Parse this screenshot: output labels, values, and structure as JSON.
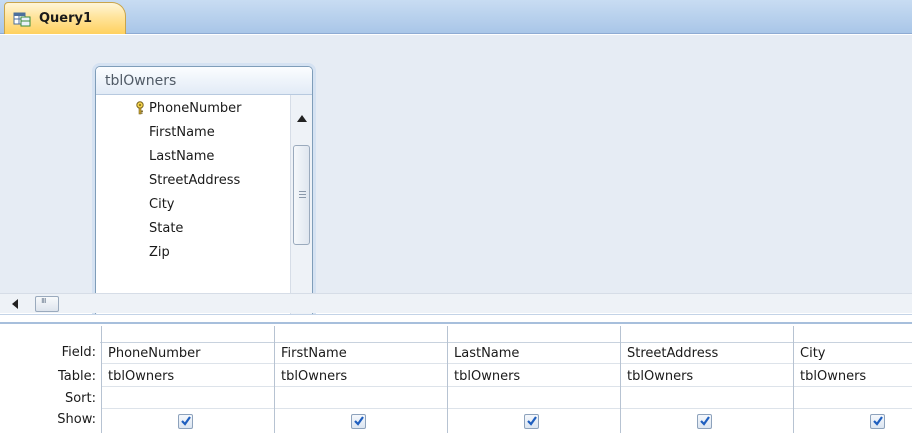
{
  "tab": {
    "title": "Query1",
    "icon": "query-icon"
  },
  "table_box": {
    "title": "tblOwners",
    "fields": [
      "PhoneNumber",
      "FirstName",
      "LastName",
      "StreetAddress",
      "City",
      "State",
      "Zip"
    ],
    "key_field_icon": "primary-key-icon"
  },
  "grid": {
    "row_labels": {
      "field": "Field:",
      "table": "Table:",
      "sort": "Sort:",
      "show": "Show:"
    },
    "columns": [
      {
        "field": "PhoneNumber",
        "table": "tblOwners",
        "sort": "",
        "show": true
      },
      {
        "field": "FirstName",
        "table": "tblOwners",
        "sort": "",
        "show": true
      },
      {
        "field": "LastName",
        "table": "tblOwners",
        "sort": "",
        "show": true
      },
      {
        "field": "StreetAddress",
        "table": "tblOwners",
        "sort": "",
        "show": true
      },
      {
        "field": "City",
        "table": "tblOwners",
        "sort": "",
        "show": true
      }
    ]
  },
  "colors": {
    "tab_active": "#ffd15f",
    "design_bg": "#e6ecf4",
    "check_mark": "#1f5fbf"
  }
}
